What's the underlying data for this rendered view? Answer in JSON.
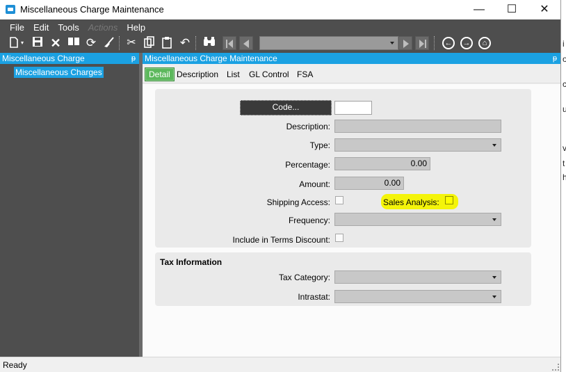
{
  "window": {
    "title": "Miscellaneous Charge Maintenance",
    "minimize": "—",
    "maximize": "☐",
    "close": "✕"
  },
  "menu": [
    "File",
    "Edit",
    "Tools",
    "Actions",
    "Help"
  ],
  "left_panel": {
    "header": "Miscellaneous Charge",
    "pin": "ᵽ",
    "tree": [
      "Miscellaneous Charges"
    ]
  },
  "main_panel": {
    "header": "Miscellaneous Charge Maintenance",
    "pin": "ᵽ",
    "tabs": [
      "Detail",
      "Description",
      "List",
      "GL Control",
      "FSA"
    ],
    "active_tab": "Detail"
  },
  "form": {
    "code_button": "Code...",
    "code_value": "",
    "description_label": "Description:",
    "description_value": "",
    "type_label": "Type:",
    "type_value": "",
    "percentage_label": "Percentage:",
    "percentage_value": "0.00",
    "amount_label": "Amount:",
    "amount_value": "0.00",
    "shipping_access_label": "Shipping Access:",
    "sales_analysis_label": "Sales Analysis:",
    "frequency_label": "Frequency:",
    "frequency_value": "",
    "include_terms_label": "Include in Terms Discount:"
  },
  "tax": {
    "section_title": "Tax Information",
    "tax_category_label": "Tax Category:",
    "tax_category_value": "",
    "intrastat_label": "Intrastat:",
    "intrastat_value": ""
  },
  "status": {
    "text": "Ready"
  },
  "colors": {
    "header_blue": "#1ba1e2",
    "toolbar_gray": "#4e4e4e",
    "active_tab_green": "#5cb85c",
    "highlight_yellow": "#f4f40a"
  }
}
